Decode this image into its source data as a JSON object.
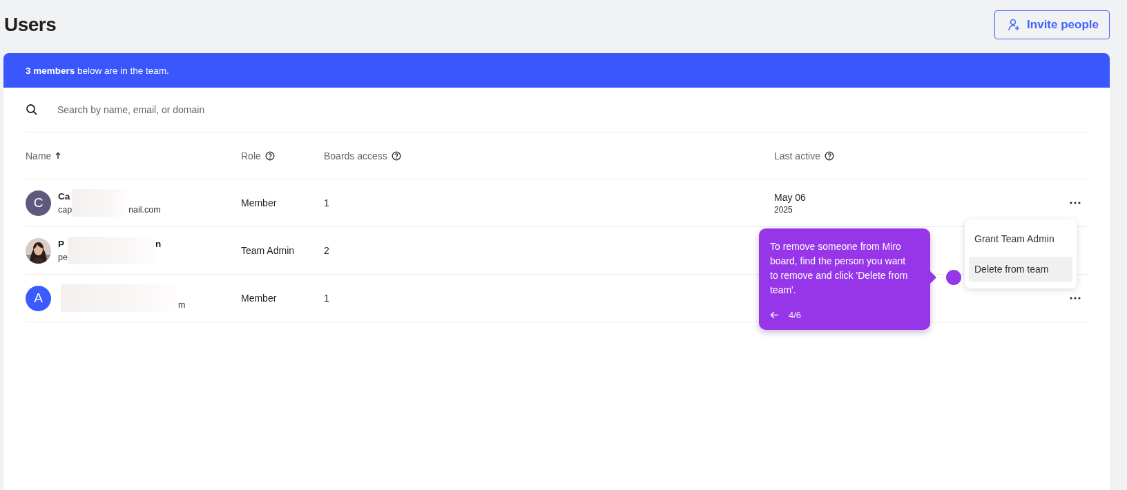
{
  "page": {
    "title": "Users"
  },
  "invite_button": {
    "label": "Invite people"
  },
  "banner": {
    "text": "**3 members** below are in the team."
  },
  "search": {
    "placeholder": "Search by name, email, or domain"
  },
  "table": {
    "columns": [
      {
        "label": "Name",
        "kind": "sort"
      },
      {
        "label": "Role",
        "kind": "help"
      },
      {
        "label": "Boards access",
        "kind": "help"
      },
      {
        "label": "Last active",
        "kind": "help"
      }
    ],
    "rows": [
      {
        "avatar": {
          "kind": "letter",
          "letter": "C",
          "color": "#5e5a7e"
        },
        "name_head": "Ca",
        "email_head": "cap",
        "email_tail": "nail.com",
        "role": "Member",
        "boards": "1",
        "last_active": "May 06",
        "last_active_year": "2025",
        "menu_button": true
      },
      {
        "name_head": "P",
        "name_tail": "n",
        "email_head": "pe",
        "role": "Team Admin",
        "boards": "2",
        "menu_button": false
      },
      {
        "avatar": {
          "kind": "letter",
          "letter": "A",
          "color": "#3c5bfd"
        },
        "email_tail": "m",
        "role": "Member",
        "boards": "1",
        "menu_button": true
      }
    ]
  },
  "row_menu": {
    "items": [
      {
        "label": "Grant Team Admin",
        "selected": false
      },
      {
        "label": "Delete from team",
        "selected": true
      }
    ]
  },
  "guide_tooltip": {
    "text": "To remove someone from Miro board, find the person you want to remove and click 'Delete from team'.",
    "step": "4/6"
  }
}
